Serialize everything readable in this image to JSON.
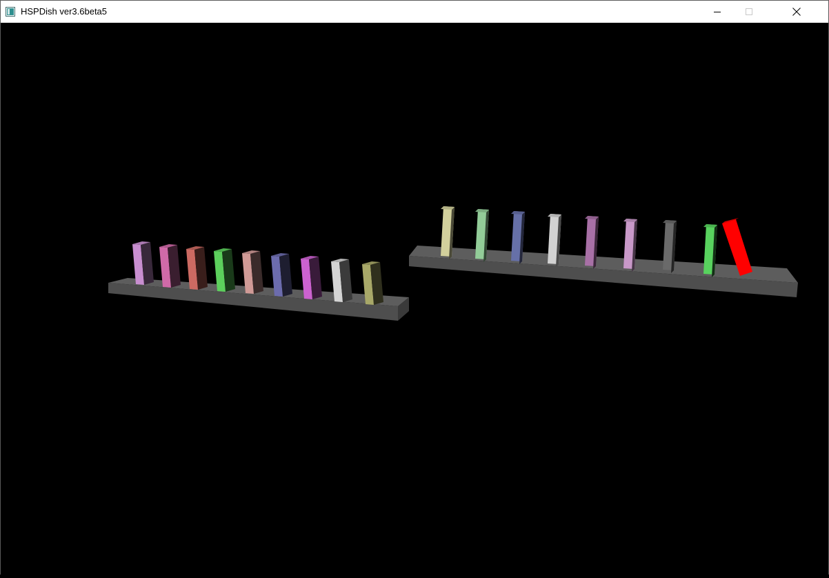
{
  "window": {
    "title": "HSPDish ver3.6beta5",
    "icons": {
      "app": "app-window-icon",
      "minimize": "minimize-icon",
      "maximize": "maximize-icon",
      "close": "close-icon"
    }
  },
  "scene": {
    "background": "#000000",
    "board_color": "#585858",
    "left_dominoes": [
      {
        "name": "domino-left-1",
        "color": "#c88ed0"
      },
      {
        "name": "domino-left-2",
        "color": "#d06aa8"
      },
      {
        "name": "domino-left-3",
        "color": "#cc6a62"
      },
      {
        "name": "domino-left-4",
        "color": "#5ccf5c"
      },
      {
        "name": "domino-left-5",
        "color": "#d09a96"
      },
      {
        "name": "domino-left-6",
        "color": "#6c6cad"
      },
      {
        "name": "domino-left-7",
        "color": "#cc62d0"
      },
      {
        "name": "domino-left-8",
        "color": "#d4d4d4"
      },
      {
        "name": "domino-left-9",
        "color": "#a8a868"
      }
    ],
    "right_dominoes": [
      {
        "name": "domino-right-1",
        "color": "#d2d09c"
      },
      {
        "name": "domino-right-2",
        "color": "#92cc98"
      },
      {
        "name": "domino-right-3",
        "color": "#6670a8"
      },
      {
        "name": "domino-right-4",
        "color": "#d2d2d2"
      },
      {
        "name": "domino-right-5",
        "color": "#a870a6"
      },
      {
        "name": "domino-right-6",
        "color": "#c898c8"
      },
      {
        "name": "domino-right-7",
        "color": "#6a6a6a"
      },
      {
        "name": "domino-right-8",
        "color": "#58d25e"
      },
      {
        "name": "domino-right-9",
        "color": "#ff0000"
      }
    ]
  }
}
